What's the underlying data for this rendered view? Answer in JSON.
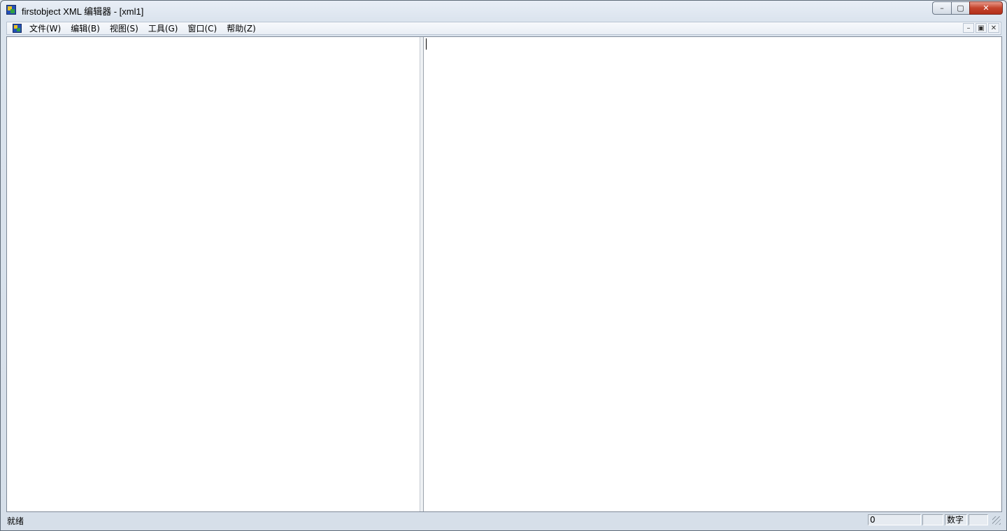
{
  "window": {
    "title": "firstobject XML 编辑器 - [xml1]"
  },
  "menu": {
    "items": [
      {
        "label": "文件(W)"
      },
      {
        "label": "编辑(B)"
      },
      {
        "label": "视图(S)"
      },
      {
        "label": "工具(G)"
      },
      {
        "label": "窗口(C)"
      },
      {
        "label": "帮助(Z)"
      }
    ]
  },
  "statusbar": {
    "message": "就绪",
    "position": "0",
    "num_indicator": "数字"
  },
  "colors": {
    "close_button": "#c4432c",
    "chrome": "#dbe4ee"
  }
}
